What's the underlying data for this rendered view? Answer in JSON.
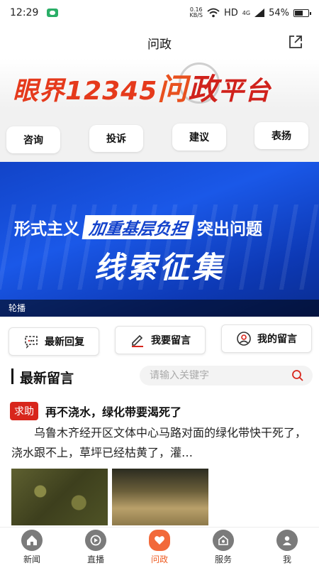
{
  "status_bar": {
    "time": "12:29",
    "net_speed_value": "0.16",
    "net_speed_unit": "KB/S",
    "network": "HD",
    "signal": "4G",
    "battery": "54%"
  },
  "header": {
    "title": "问政",
    "share_icon": "share-icon"
  },
  "banner": {
    "part1": "眼界",
    "part2": "12345",
    "part3": "问",
    "part4": "政",
    "part5": "平台"
  },
  "categories": [
    "咨询",
    "投诉",
    "建议",
    "表扬"
  ],
  "carousel": {
    "line1_a": "形式主义",
    "line1_highlight": "加重基层负担",
    "line1_b": "突出问题",
    "line2": "线索征集",
    "caption": "轮播"
  },
  "actions": {
    "latest_reply": "最新回复",
    "leave_message": "我要留言",
    "my_messages": "我的留言"
  },
  "section": {
    "title": "最新留言",
    "search_placeholder": "请输入关键字"
  },
  "post": {
    "tag": "求助",
    "title": "再不浇水，绿化带要渴死了",
    "body": "乌鲁木齐经开区文体中心马路对面的绿化带快干死了，浇水跟不上，草坪已经枯黄了，灌…"
  },
  "tabbar": {
    "items": [
      {
        "label": "新闻",
        "icon": "home-icon"
      },
      {
        "label": "直播",
        "icon": "live-icon"
      },
      {
        "label": "问政",
        "icon": "heart-icon"
      },
      {
        "label": "服务",
        "icon": "service-icon"
      },
      {
        "label": "我",
        "icon": "user-icon"
      }
    ],
    "active_color": "#ee5a20"
  },
  "colors": {
    "accent": "#d8261c",
    "carousel_blue": "#1a58e8"
  }
}
